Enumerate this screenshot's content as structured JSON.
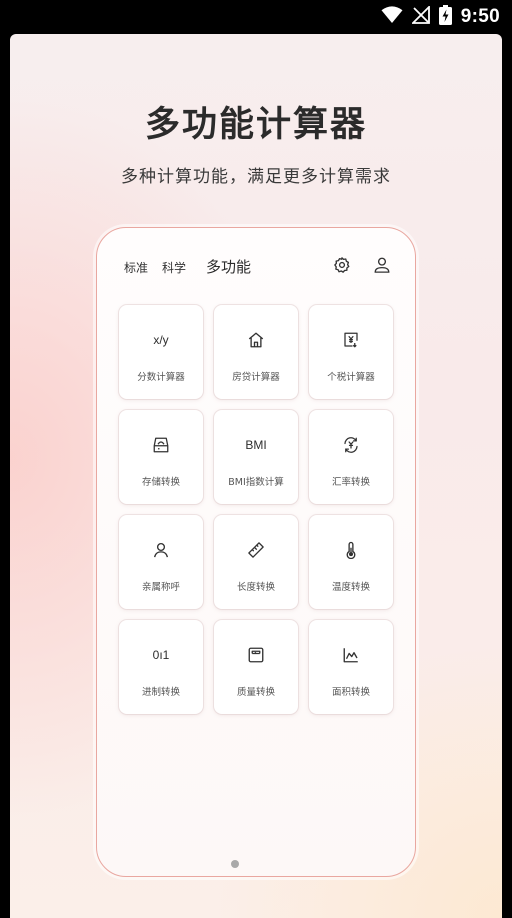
{
  "status_bar": {
    "time": "9:50",
    "icons": [
      "wifi-icon",
      "no-signal-icon",
      "battery-charging-icon"
    ]
  },
  "promo": {
    "title": "多功能计算器",
    "subtitle": "多种计算功能，满足更多计算需求"
  },
  "app": {
    "tabs": [
      {
        "label": "标准"
      },
      {
        "label": "科学"
      },
      {
        "label": "多功能"
      }
    ],
    "actions": [
      "settings-icon",
      "user-icon"
    ],
    "tools": [
      {
        "label": "分数计算器",
        "icon": "fraction-icon",
        "icon_text": "x/y"
      },
      {
        "label": "房贷计算器",
        "icon": "house-icon",
        "icon_text": ""
      },
      {
        "label": "个税计算器",
        "icon": "tax-icon",
        "icon_text": ""
      },
      {
        "label": "存储转换",
        "icon": "storage-icon",
        "icon_text": ""
      },
      {
        "label": "BMI指数计算",
        "icon": "bmi-icon",
        "icon_text": "BMI"
      },
      {
        "label": "汇率转换",
        "icon": "exchange-icon",
        "icon_text": ""
      },
      {
        "label": "亲属称呼",
        "icon": "person-icon",
        "icon_text": ""
      },
      {
        "label": "长度转换",
        "icon": "ruler-icon",
        "icon_text": ""
      },
      {
        "label": "温度转换",
        "icon": "thermometer-icon",
        "icon_text": ""
      },
      {
        "label": "进制转换",
        "icon": "binary-icon",
        "icon_text": "0ı1"
      },
      {
        "label": "质量转换",
        "icon": "scale-icon",
        "icon_text": ""
      },
      {
        "label": "面积转换",
        "icon": "area-chart-icon",
        "icon_text": ""
      }
    ]
  },
  "colors": {
    "frame_border": "#e9a7a0",
    "text_dark": "#2b2b2b"
  }
}
